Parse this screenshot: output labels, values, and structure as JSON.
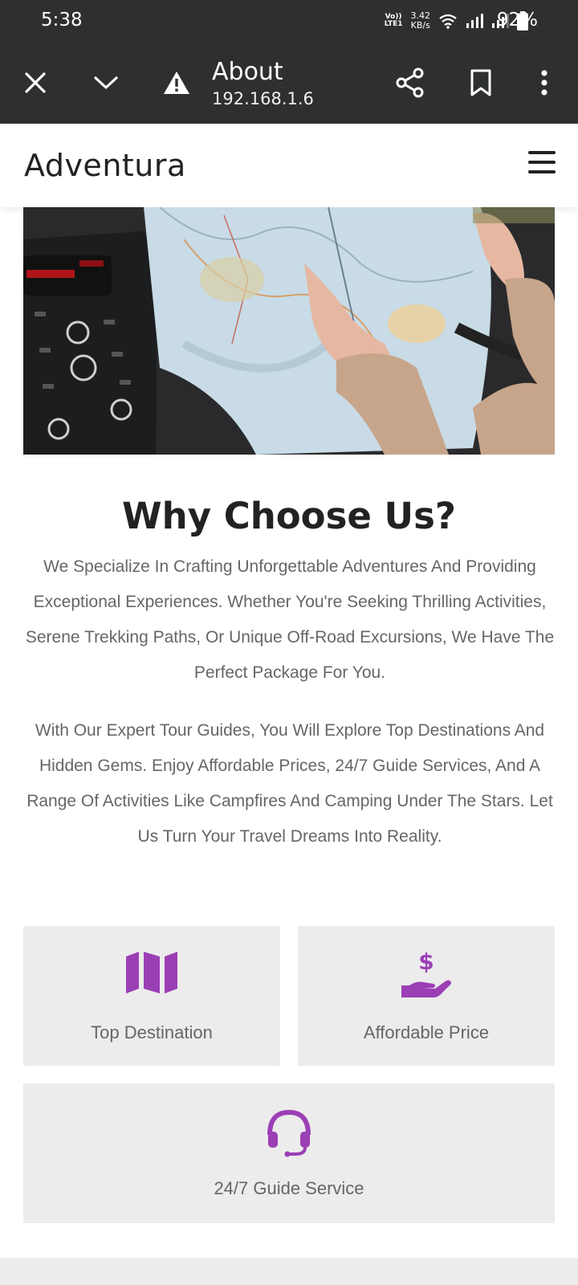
{
  "status_bar": {
    "time": "5:38",
    "volte_top": "Vo))",
    "volte_bottom": "LTE1",
    "net_speed_value": "3.42",
    "net_speed_unit": "KB/s",
    "battery": "92%"
  },
  "toolbar": {
    "page_title": "About",
    "url": "192.168.1.6",
    "icons": [
      "close-icon",
      "chevron-down-icon",
      "warning-icon",
      "share-icon",
      "bookmark-icon",
      "more-vert-icon"
    ]
  },
  "site": {
    "brand": "Adventura",
    "menu_icon": "hamburger-menu-icon"
  },
  "section": {
    "heading": "Why Choose Us?",
    "paragraph1": "We Specialize In Crafting Unforgettable Adventures And Providing Exceptional Experiences. Whether You're Seeking Thrilling Activities, Serene Trekking Paths, Or Unique Off-Road Excursions, We Have The Perfect Package For You.",
    "paragraph2": "With Our Expert Tour Guides, You Will Explore Top Destinations And Hidden Gems. Enjoy Affordable Prices, 24/7 Guide Services, And A Range Of Activities Like Campfires And Camping Under The Stars. Let Us Turn Your Travel Dreams Into Reality."
  },
  "features": [
    {
      "label": "Top Destination",
      "icon": "map-icon"
    },
    {
      "label": "Affordable Price",
      "icon": "hand-dollar-icon"
    },
    {
      "label": "24/7 Guide Service",
      "icon": "headset-icon"
    }
  ],
  "colors": {
    "accent": "#9b3fb5",
    "card_bg": "#ececec",
    "chrome_bg": "#2d2f31"
  }
}
